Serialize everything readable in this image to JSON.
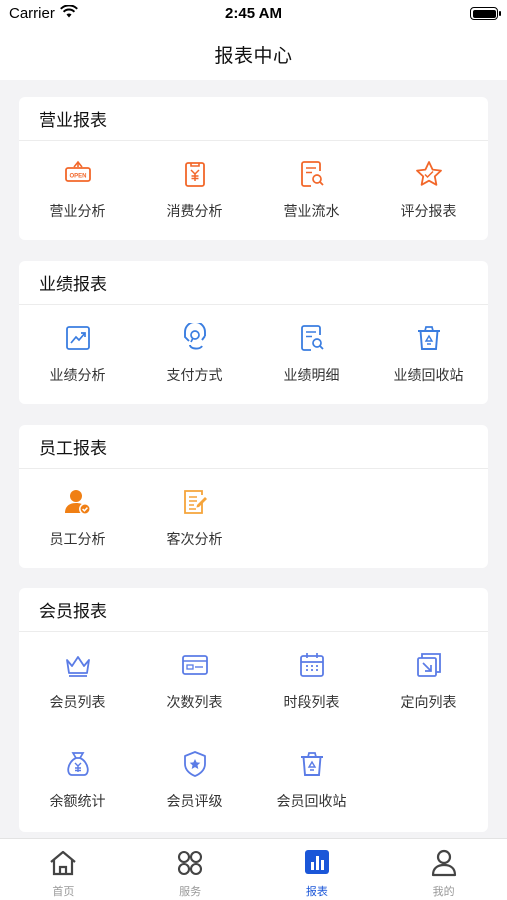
{
  "status_bar": {
    "carrier": "Carrier",
    "time": "2:45 AM"
  },
  "nav": {
    "title": "报表中心"
  },
  "sections": [
    {
      "title": "营业报表",
      "items": [
        {
          "label": "营业分析",
          "icon": "open-sign-icon"
        },
        {
          "label": "消费分析",
          "icon": "yen-receipt-icon"
        },
        {
          "label": "营业流水",
          "icon": "document-search-icon"
        },
        {
          "label": "评分报表",
          "icon": "star-icon"
        }
      ]
    },
    {
      "title": "业绩报表",
      "items": [
        {
          "label": "业绩分析",
          "icon": "trend-chart-icon"
        },
        {
          "label": "支付方式",
          "icon": "payment-hand-icon"
        },
        {
          "label": "业绩明细",
          "icon": "document-search-icon"
        },
        {
          "label": "业绩回收站",
          "icon": "recycle-bin-icon"
        }
      ]
    },
    {
      "title": "员工报表",
      "items": [
        {
          "label": "员工分析",
          "icon": "person-check-icon"
        },
        {
          "label": "客次分析",
          "icon": "notepad-icon"
        }
      ]
    },
    {
      "title": "会员报表",
      "items": [
        {
          "label": "会员列表",
          "icon": "crown-icon"
        },
        {
          "label": "次数列表",
          "icon": "card-icon"
        },
        {
          "label": "时段列表",
          "icon": "calendar-icon"
        },
        {
          "label": "定向列表",
          "icon": "directional-arrow-icon"
        },
        {
          "label": "余额统计",
          "icon": "money-bag-icon"
        },
        {
          "label": "会员评级",
          "icon": "shield-star-icon"
        },
        {
          "label": "会员回收站",
          "icon": "recycle-bin-icon"
        }
      ]
    }
  ],
  "tabs": [
    {
      "label": "首页",
      "icon": "home-icon"
    },
    {
      "label": "服务",
      "icon": "grid-icon"
    },
    {
      "label": "报表",
      "icon": "bar-chart-icon"
    },
    {
      "label": "我的",
      "icon": "user-icon"
    }
  ],
  "colors": {
    "orange": "#f2672a",
    "blue": "#3a7de0",
    "member_blue": "#5b7ce6",
    "active": "#1a56d8"
  }
}
